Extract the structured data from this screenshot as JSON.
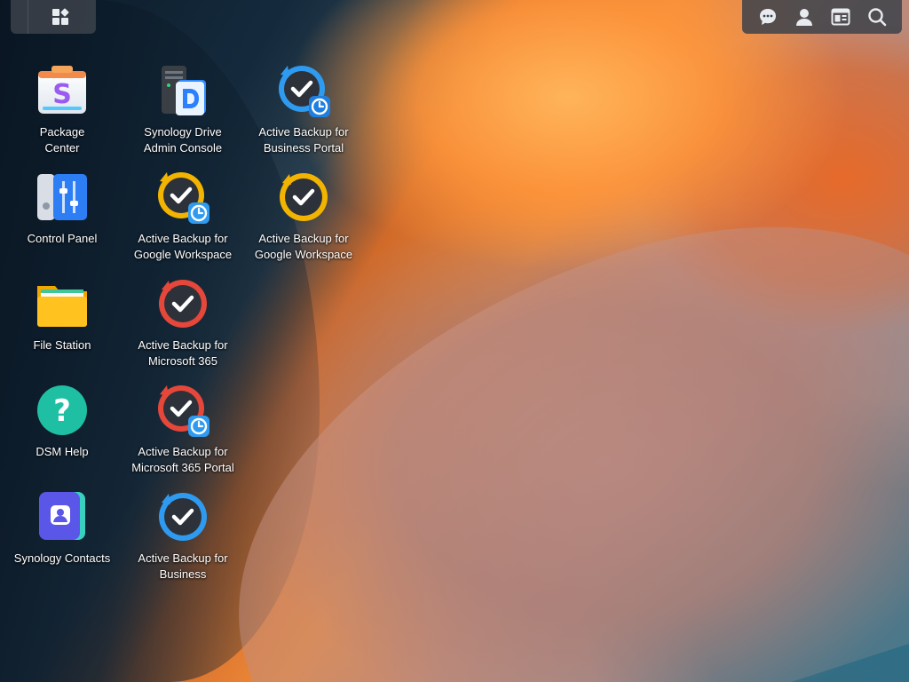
{
  "desktop": {
    "shortcuts": [
      {
        "label": "Package\nCenter",
        "icon": "package-center-icon"
      },
      {
        "label": "Synology Drive\nAdmin Console",
        "icon": "synology-drive-icon"
      },
      {
        "label": "Active Backup for\nBusiness Portal",
        "icon": "active-backup-portal-icon"
      },
      {
        "label": "Control Panel",
        "icon": "control-panel-icon"
      },
      {
        "label": "Active Backup for\nGoogle Workspace",
        "icon": "active-backup-google-portal-icon"
      },
      {
        "label": "Active Backup for\nGoogle Workspace",
        "icon": "active-backup-google-icon"
      },
      {
        "label": "File Station",
        "icon": "file-station-icon"
      },
      {
        "label": "Active Backup for\nMicrosoft 365",
        "icon": "active-backup-m365-icon"
      },
      {
        "label": "DSM Help",
        "icon": "dsm-help-icon"
      },
      {
        "label": "Active Backup for\nMicrosoft 365 Portal",
        "icon": "active-backup-m365-portal-icon"
      },
      {
        "label": "Synology Contacts",
        "icon": "synology-contacts-icon"
      },
      {
        "label": "Active Backup for\nBusiness",
        "icon": "active-backup-business-icon"
      }
    ]
  },
  "taskbar": {
    "main_menu_icon": "main-menu-icon",
    "tray": [
      "chat-icon",
      "user-icon",
      "widgets-icon",
      "search-icon"
    ]
  },
  "colors": {
    "backup_blue": "#2e9bf0",
    "backup_yellow": "#f2b400",
    "backup_red": "#e5473a",
    "help_teal": "#1fbfa3"
  }
}
